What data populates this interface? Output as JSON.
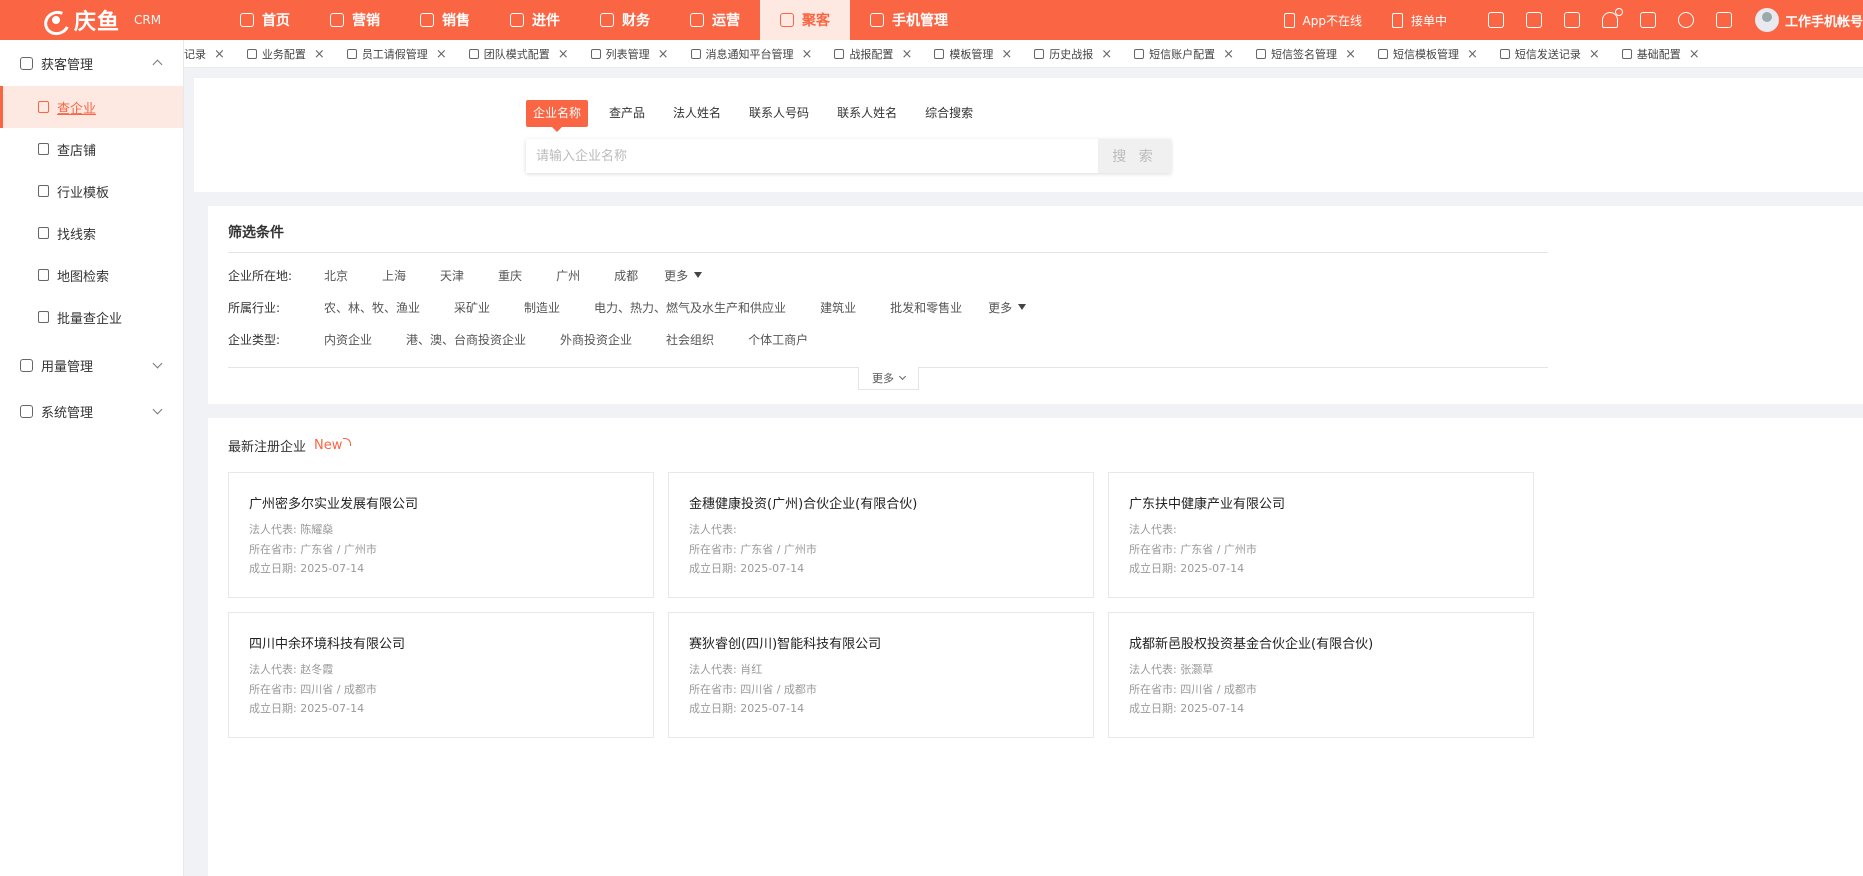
{
  "brand": {
    "name": "庆鱼",
    "sub": "CRM"
  },
  "topnav": [
    {
      "label": "首页",
      "icon": "home-icon",
      "active": false
    },
    {
      "label": "营销",
      "icon": "marketing-icon",
      "active": false
    },
    {
      "label": "销售",
      "icon": "sales-icon",
      "active": false
    },
    {
      "label": "进件",
      "icon": "application-icon",
      "active": false
    },
    {
      "label": "财务",
      "icon": "finance-icon",
      "active": false
    },
    {
      "label": "运营",
      "icon": "operations-icon",
      "active": false
    },
    {
      "label": "聚客",
      "icon": "customer-icon",
      "active": true
    },
    {
      "label": "手机管理",
      "icon": "phone-manage-icon",
      "active": false
    }
  ],
  "topright": {
    "app_status": "App不在线",
    "order_status": "接单中",
    "user_name": "工作手机帐号"
  },
  "sidebar": {
    "group1": "获客管理",
    "items": [
      {
        "label": "查企业",
        "icon": "company-search-icon",
        "active": true
      },
      {
        "label": "查店铺",
        "icon": "store-icon",
        "active": false
      },
      {
        "label": "行业模板",
        "icon": "template-icon",
        "active": false
      },
      {
        "label": "找线索",
        "icon": "search-icon",
        "active": false
      },
      {
        "label": "地图检索",
        "icon": "map-icon",
        "active": false
      },
      {
        "label": "批量查企业",
        "icon": "batch-icon",
        "active": false
      }
    ],
    "group2": "用量管理",
    "group3": "系统管理"
  },
  "tabs": [
    "记录",
    "业务配置",
    "员工请假管理",
    "团队模式配置",
    "列表管理",
    "消息通知平台管理",
    "战报配置",
    "模板管理",
    "历史战报",
    "短信账户配置",
    "短信签名管理",
    "短信模板管理",
    "短信发送记录",
    "基础配置"
  ],
  "search": {
    "tabs": [
      "企业名称",
      "查产品",
      "法人姓名",
      "联系人号码",
      "联系人姓名",
      "综合搜索"
    ],
    "placeholder": "请输入企业名称",
    "button": "搜 索"
  },
  "filter": {
    "title": "筛选条件",
    "location_label": "企业所在地:",
    "locations": [
      "北京",
      "上海",
      "天津",
      "重庆",
      "广州",
      "成都"
    ],
    "industry_label": "所属行业:",
    "industries": [
      "农、林、牧、渔业",
      "采矿业",
      "制造业",
      "电力、热力、燃气及水生产和供应业",
      "建筑业",
      "批发和零售业"
    ],
    "type_label": "企业类型:",
    "types": [
      "内资企业",
      "港、澳、台商投资企业",
      "外商投资企业",
      "社会组织",
      "个体工商户"
    ],
    "more": "更多",
    "expand": "更多"
  },
  "latest": {
    "title": "最新注册企业",
    "badge": "New",
    "labels": {
      "legal": "法人代表:",
      "location": "所在省市:",
      "date": "成立日期:"
    },
    "companies": [
      {
        "name": "广州密多尔实业发展有限公司",
        "legal": "陈耀燊",
        "location": "广东省 / 广州市",
        "date": "2025-07-14"
      },
      {
        "name": "金穗健康投资(广州)合伙企业(有限合伙)",
        "legal": "",
        "location": "广东省 / 广州市",
        "date": "2025-07-14"
      },
      {
        "name": "广东扶中健康产业有限公司",
        "legal": "",
        "location": "广东省 / 广州市",
        "date": "2025-07-14"
      },
      {
        "name": "四川中余环境科技有限公司",
        "legal": "赵冬霞",
        "location": "四川省 / 成都市",
        "date": "2025-07-14"
      },
      {
        "name": "赛狄睿创(四川)智能科技有限公司",
        "legal": "肖红",
        "location": "四川省 / 成都市",
        "date": "2025-07-14"
      },
      {
        "name": "成都新邑股权投资基金合伙企业(有限合伙)",
        "legal": "张灏草",
        "location": "四川省 / 成都市",
        "date": "2025-07-14"
      }
    ]
  }
}
